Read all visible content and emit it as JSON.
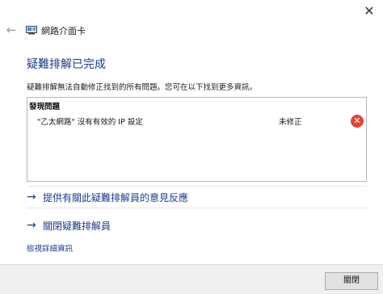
{
  "window": {
    "close_glyph": "✕"
  },
  "nav": {
    "back_glyph": "←",
    "title": "網路介面卡"
  },
  "main": {
    "heading": "疑難排解已完成",
    "subtitle": "疑難排解無法自動修正找到的所有問題。您可在以下找到更多資訊。",
    "results": {
      "header": "發現問題",
      "rows": [
        {
          "problem": "\"乙太網路\" 沒有有效的 IP 設定",
          "status": "未修正",
          "status_icon": "error-icon",
          "icon_glyph": "✕"
        }
      ]
    },
    "links": [
      {
        "arrow": "→",
        "label": "提供有關此疑難排解員的意見反應"
      },
      {
        "arrow": "→",
        "label": "關閉疑難排解員"
      }
    ],
    "details_link": "檢視詳細資訊"
  },
  "footer": {
    "close_button": "關閉"
  },
  "colors": {
    "accent": "#1a3a8a",
    "error": "#e0463a"
  }
}
